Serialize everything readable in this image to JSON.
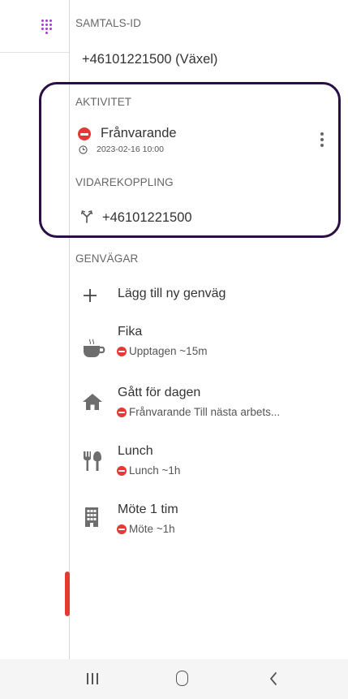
{
  "header": {
    "label": "SAMTALS-ID",
    "number": "+46101221500 (Växel)"
  },
  "activity": {
    "label": "AKTIVITET",
    "status": "Frånvarande",
    "timestamp": "2023-02-16 10:00"
  },
  "forwarding": {
    "label": "VIDAREKOPPLING",
    "number": "+46101221500"
  },
  "shortcuts": {
    "label": "GENVÄGAR",
    "add_label": "Lägg till ny genväg",
    "items": [
      {
        "title": "Fika",
        "status": "Upptagen ~15m",
        "icon": "coffee-icon"
      },
      {
        "title": "Gått för dagen",
        "status": "Frånvarande Till nästa arbets...",
        "icon": "home-icon"
      },
      {
        "title": "Lunch",
        "status": "Lunch ~1h",
        "icon": "restaurant-icon"
      },
      {
        "title": "Möte 1 tim",
        "status": "Möte ~1h",
        "icon": "building-icon"
      }
    ]
  },
  "colors": {
    "status_red": "#e53935",
    "dialpad_purple": "#a23ad3",
    "highlight_outline": "#2a0f45"
  }
}
